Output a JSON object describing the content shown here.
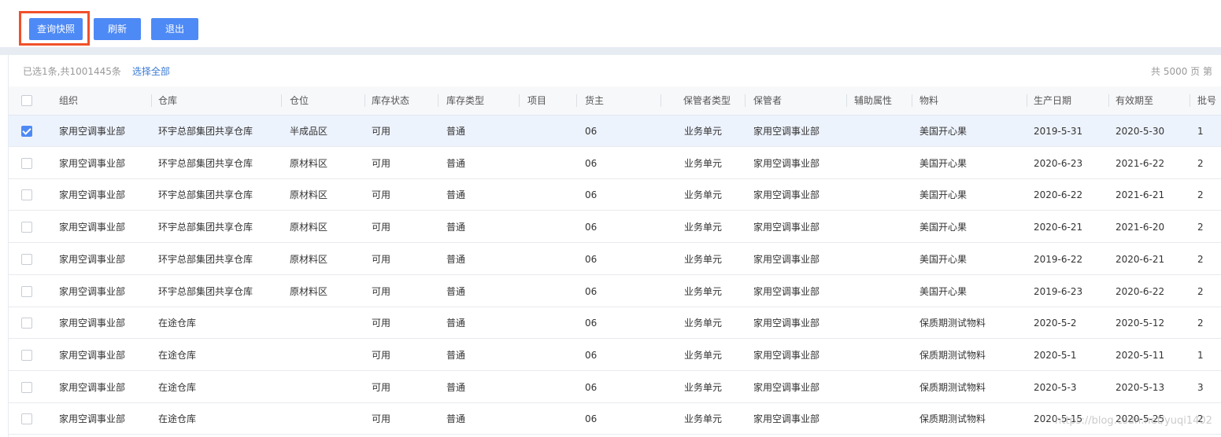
{
  "toolbar": {
    "query_snapshot_label": "查询快照",
    "refresh_label": "刷新",
    "exit_label": "退出"
  },
  "status": {
    "selected_text": "已选1条,共1001445条",
    "select_all_label": "选择全部",
    "page_count_text": "共 5000 页  第"
  },
  "table": {
    "columns": [
      "组织",
      "仓库",
      "仓位",
      "库存状态",
      "库存类型",
      "项目",
      "货主",
      "保管者类型",
      "保管者",
      "辅助属性",
      "物料",
      "生产日期",
      "有效期至",
      "批号"
    ],
    "rows": [
      {
        "checked": true,
        "cells": [
          "家用空调事业部",
          "环宇总部集团共享仓库",
          "半成品区",
          "可用",
          "普通",
          "",
          "06",
          "业务单元",
          "家用空调事业部",
          "",
          "美国开心果",
          "2019-5-31",
          "2020-5-30",
          "1"
        ]
      },
      {
        "checked": false,
        "cells": [
          "家用空调事业部",
          "环宇总部集团共享仓库",
          "原材料区",
          "可用",
          "普通",
          "",
          "06",
          "业务单元",
          "家用空调事业部",
          "",
          "美国开心果",
          "2020-6-23",
          "2021-6-22",
          "2"
        ]
      },
      {
        "checked": false,
        "cells": [
          "家用空调事业部",
          "环宇总部集团共享仓库",
          "原材料区",
          "可用",
          "普通",
          "",
          "06",
          "业务单元",
          "家用空调事业部",
          "",
          "美国开心果",
          "2020-6-22",
          "2021-6-21",
          "2"
        ]
      },
      {
        "checked": false,
        "cells": [
          "家用空调事业部",
          "环宇总部集团共享仓库",
          "原材料区",
          "可用",
          "普通",
          "",
          "06",
          "业务单元",
          "家用空调事业部",
          "",
          "美国开心果",
          "2020-6-21",
          "2021-6-20",
          "2"
        ]
      },
      {
        "checked": false,
        "cells": [
          "家用空调事业部",
          "环宇总部集团共享仓库",
          "原材料区",
          "可用",
          "普通",
          "",
          "06",
          "业务单元",
          "家用空调事业部",
          "",
          "美国开心果",
          "2019-6-22",
          "2020-6-21",
          "2"
        ]
      },
      {
        "checked": false,
        "cells": [
          "家用空调事业部",
          "环宇总部集团共享仓库",
          "原材料区",
          "可用",
          "普通",
          "",
          "06",
          "业务单元",
          "家用空调事业部",
          "",
          "美国开心果",
          "2019-6-23",
          "2020-6-22",
          "2"
        ]
      },
      {
        "checked": false,
        "cells": [
          "家用空调事业部",
          "在途仓库",
          "",
          "可用",
          "普通",
          "",
          "06",
          "业务单元",
          "家用空调事业部",
          "",
          "保质期测试物料",
          "2020-5-2",
          "2020-5-12",
          "2"
        ]
      },
      {
        "checked": false,
        "cells": [
          "家用空调事业部",
          "在途仓库",
          "",
          "可用",
          "普通",
          "",
          "06",
          "业务单元",
          "家用空调事业部",
          "",
          "保质期测试物料",
          "2020-5-1",
          "2020-5-11",
          "1"
        ]
      },
      {
        "checked": false,
        "cells": [
          "家用空调事业部",
          "在途仓库",
          "",
          "可用",
          "普通",
          "",
          "06",
          "业务单元",
          "家用空调事业部",
          "",
          "保质期测试物料",
          "2020-5-3",
          "2020-5-13",
          "3"
        ]
      },
      {
        "checked": false,
        "cells": [
          "家用空调事业部",
          "在途仓库",
          "",
          "可用",
          "普通",
          "",
          "06",
          "业务单元",
          "家用空调事业部",
          "",
          "保质期测试物料",
          "2020-5-15",
          "2020-5-25",
          "2"
        ]
      }
    ]
  },
  "watermark": "https://blog.csdn.net/yuqi1402",
  "colors": {
    "accent": "#4e8af5",
    "highlight": "#f0502a",
    "link": "#3a7bd5",
    "selected_row": "#edf3fd"
  }
}
